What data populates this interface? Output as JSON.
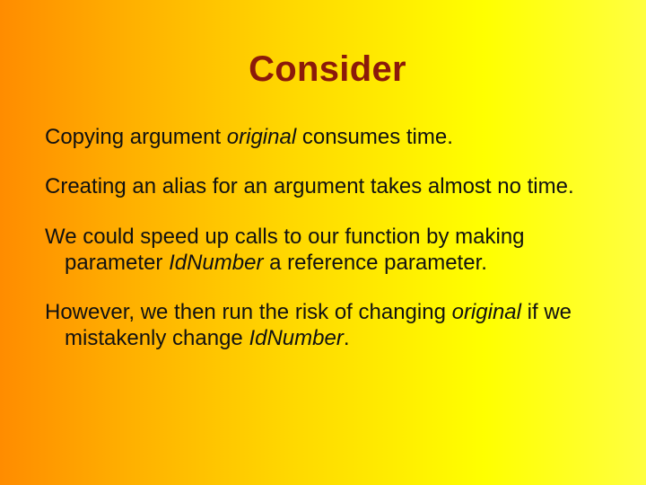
{
  "title": "Consider",
  "p1": {
    "a": "Copying argument ",
    "b": "original",
    "c": " consumes time."
  },
  "p2": "Creating an alias for an argument takes almost no time.",
  "p3": {
    "a": "We could speed up calls to our function by making parameter ",
    "b": "IdNumber",
    "c": " a reference parameter."
  },
  "p4": {
    "a": "However, we then run the risk of changing ",
    "b": "original",
    "c": " if we mistakenly change ",
    "d": "IdNumber",
    "e": "."
  }
}
